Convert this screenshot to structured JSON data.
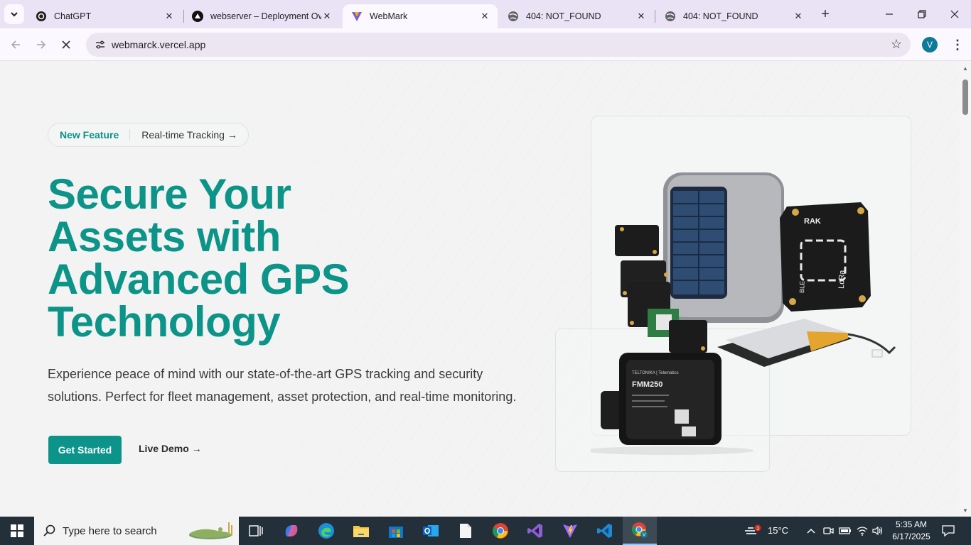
{
  "browser": {
    "tabs": [
      {
        "title": "ChatGPT",
        "icon": "chatgpt-icon",
        "active": false
      },
      {
        "title": "webserver – Deployment Ov",
        "icon": "vercel-icon",
        "active": false
      },
      {
        "title": "WebMark",
        "icon": "webmark-icon",
        "active": true
      },
      {
        "title": "404: NOT_FOUND",
        "icon": "globe-icon",
        "active": false
      },
      {
        "title": "404: NOT_FOUND",
        "icon": "globe-icon",
        "active": false
      }
    ],
    "url": "webmarck.vercel.app",
    "profile_initial": "V"
  },
  "page": {
    "badge_tag": "New Feature",
    "badge_link": "Real-time Tracking →",
    "headline_lines": [
      "Secure Your",
      "Assets with",
      "Advanced GPS",
      "Technology"
    ],
    "subtext": "Experience peace of mind with our state-of-the-art GPS tracking and security solutions. Perfect for fleet management, asset protection, and real-time monitoring.",
    "cta_primary": "Get Started",
    "cta_secondary": "Live Demo →",
    "device_labels": {
      "tracker_model": "FMM250",
      "tracker_brand": "TELTONIKA | Telematics",
      "board_brand": "RAK",
      "board_lora": "LoRa",
      "board_ble": "BLE"
    }
  },
  "taskbar": {
    "search_placeholder": "Type here to search",
    "weather": "15°C",
    "weather_badge": "1",
    "time": "5:35 AM",
    "date": "6/17/2025"
  },
  "colors": {
    "accent": "#0d9488",
    "tab_strip": "#e9e3f5",
    "taskbar": "#23303a"
  }
}
